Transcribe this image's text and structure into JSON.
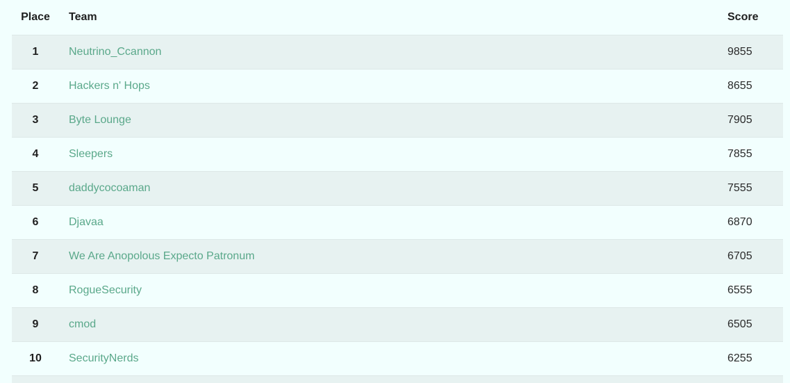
{
  "header": {
    "place": "Place",
    "team": "Team",
    "score": "Score"
  },
  "rows": [
    {
      "place": "1",
      "team": "Neutrino_Ccannon",
      "score": "9855"
    },
    {
      "place": "2",
      "team": "Hackers n' Hops",
      "score": "8655"
    },
    {
      "place": "3",
      "team": "Byte Lounge",
      "score": "7905"
    },
    {
      "place": "4",
      "team": "Sleepers",
      "score": "7855"
    },
    {
      "place": "5",
      "team": "daddycocoaman",
      "score": "7555"
    },
    {
      "place": "6",
      "team": "Djavaa",
      "score": "6870"
    },
    {
      "place": "7",
      "team": "We Are Anopolous Expecto Patronum",
      "score": "6705"
    },
    {
      "place": "8",
      "team": "RogueSecurity",
      "score": "6555"
    },
    {
      "place": "9",
      "team": "cmod",
      "score": "6505"
    },
    {
      "place": "10",
      "team": "SecurityNerds",
      "score": "6255"
    }
  ],
  "colors": {
    "background": "#f2fffe",
    "stripe": "#e7f2f1",
    "team_link": "#5aa88a",
    "divider": "#dde8e7"
  }
}
